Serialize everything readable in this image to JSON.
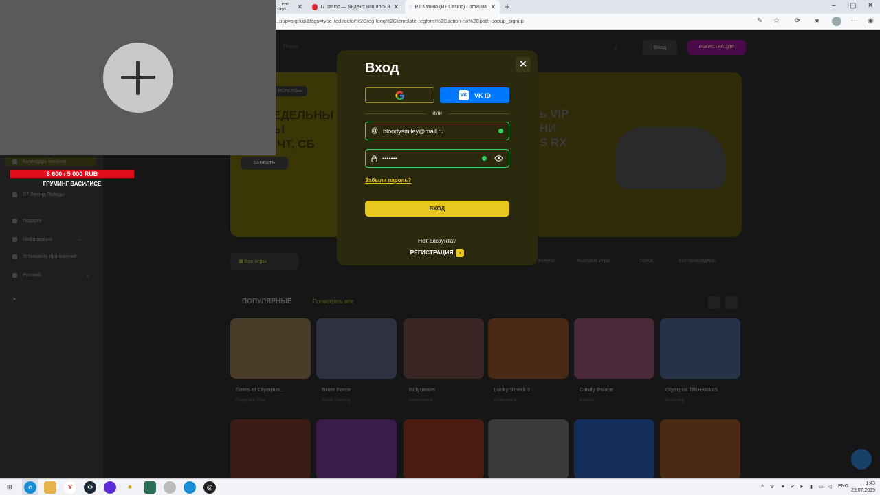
{
  "browser": {
    "tabs": [
      {
        "title": "...ево онл..."
      },
      {
        "title": "r7 casino — Яндекс: нашлось 3 ..."
      },
      {
        "title": "Р7 Казино (R7 Casino) - официа..."
      }
    ],
    "url": "...pup=signup&tags=type-redirector%2Creg-long%2Ctemplate-regform%2Caction-no%2Cpath-popup_signup"
  },
  "site": {
    "search_placeholder": "Поиск",
    "login_button": "Вход",
    "register_button": "РЕГИСТРАЦИЯ",
    "banner_chip": "BONUSES",
    "banner_left_text": "НЕДЕЛЬНЫ\nСЫ\nТ, ЧТ, СБ",
    "banner_button": "ЗАБРАТЬ",
    "banner_right_text": "ь VIP\nНИ\nS RX",
    "filter_active": "Все игры",
    "filters": [
      "Бонусы",
      "Быстрые Игры",
      "Поиск",
      "Все провайдеры"
    ],
    "section_title": "ПОПУЛЯРНЫЕ",
    "section_link": "Посмотреть все",
    "sidebar_items": [
      "Календарь бонусов",
      "R7 Легенд Победы",
      "Подарки",
      "Информация",
      "Установить приложение",
      "Русский"
    ],
    "games_row1": [
      {
        "name": "Gates of Olympus...",
        "provider": "Pragmatic Play",
        "color": "#4a3b26"
      },
      {
        "name": "Brute Force",
        "provider": "Relax Gaming",
        "color": "#2e3140"
      },
      {
        "name": "Billyonaire",
        "provider": "Spinomenal",
        "color": "#3a2525"
      },
      {
        "name": "Lucky Streak 3",
        "provider": "Endorphina",
        "color": "#4a2a14"
      },
      {
        "name": "Candy Palace",
        "provider": "Belatra",
        "color": "#4a2a3a"
      },
      {
        "name": "Olympus TRUEWAYS",
        "provider": "BGaming",
        "color": "#253248"
      }
    ],
    "games_row2": [
      {
        "color": "#3a1c14"
      },
      {
        "color": "#3a1c4a"
      },
      {
        "color": "#4a1c10"
      },
      {
        "color": "#3a3a3a"
      },
      {
        "color": "#14305a"
      },
      {
        "color": "#4a2a14"
      }
    ]
  },
  "overlay": {
    "donation_amount": "8 600 / 5 000 RUB",
    "donation_title": "ГРУМИНГ ВАСИЛИСЕ"
  },
  "modal": {
    "title": "Вход",
    "vk_label": "VK ID",
    "or_text": "или",
    "email_value": "bloodysmiley@mail.ru",
    "password_value": "•••••••",
    "forgot": "Забыли пароль?",
    "submit": "ВХОД",
    "no_account": "Нет аккаунта?",
    "register": "РЕГИСТРАЦИЯ"
  },
  "taskbar": {
    "lang": "ENG",
    "time": "1:43",
    "date": "23.07.2025"
  }
}
